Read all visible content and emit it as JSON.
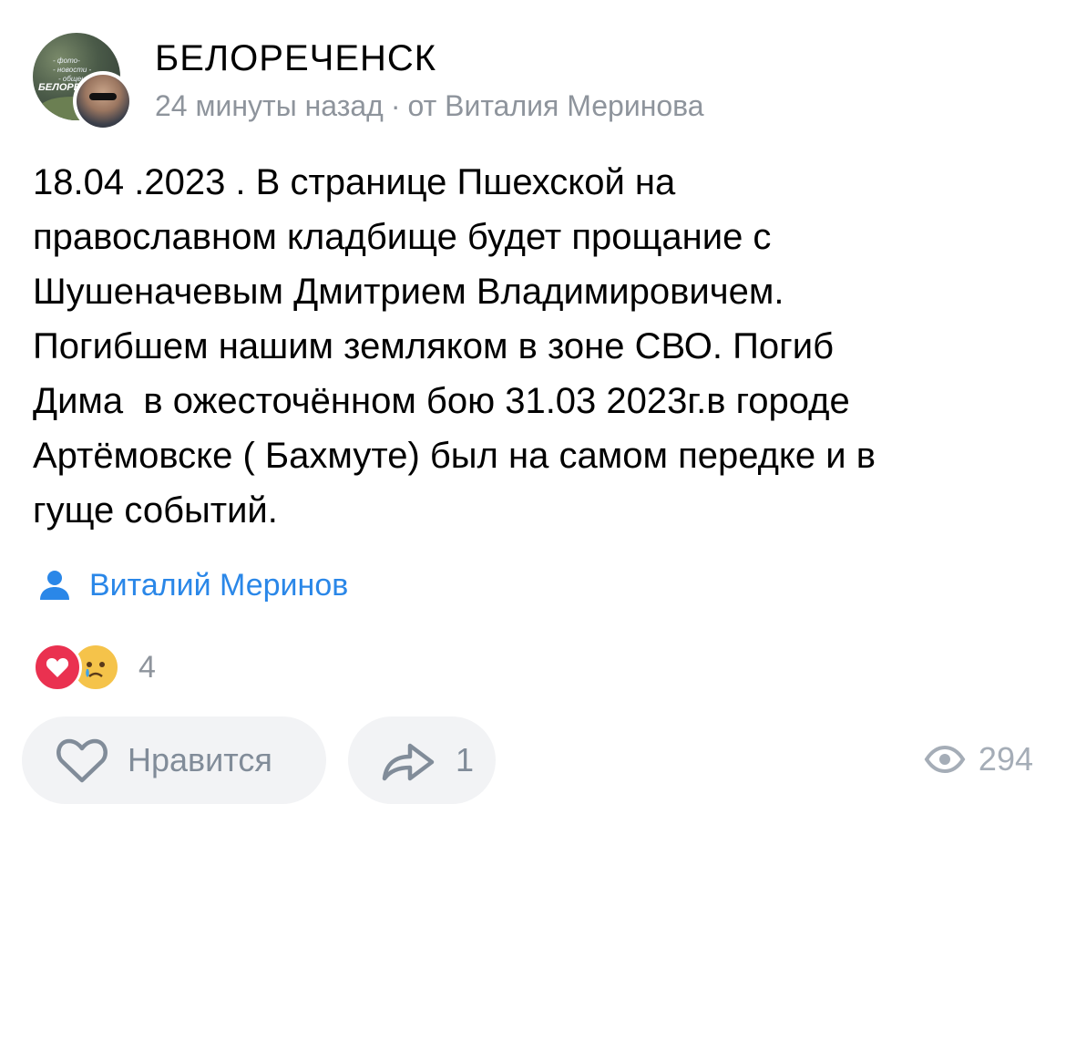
{
  "header": {
    "group_name": "БЕЛОРЕЧЕНСК",
    "time": "24 минуты назад",
    "separator": "·",
    "author_line": "от Виталия Меринова",
    "group_avatar_text": {
      "line1": "- фото-",
      "line2": "- новости -",
      "line3": "- общение",
      "brand": "БЕЛОРЕ"
    }
  },
  "post": {
    "text": "18.04 .2023 . В странице Пшехской на\nправославном кладбище будет прощание с\nШушеначевым Дмитрием Владимировичем.\nПогибшем нашим земляком в зоне СВО. Погиб\nДима  в ожесточённом бою 31.03 2023г.в городе\nАртёмовске ( Бахмуте) был на самом передке и в\nгуще событий."
  },
  "signature": {
    "icon": "user-icon",
    "name": "Виталий Меринов"
  },
  "reactions": {
    "icons": [
      "heart-icon",
      "crying-face-icon"
    ],
    "count": "4"
  },
  "actions": {
    "like_label": "Нравится",
    "share_count": "1",
    "views_count": "294"
  },
  "colors": {
    "link": "#2a87e8",
    "meta": "#8e949c",
    "button_bg": "#f2f3f5",
    "heart": "#ea3150",
    "emoji": "#f5c34a"
  }
}
